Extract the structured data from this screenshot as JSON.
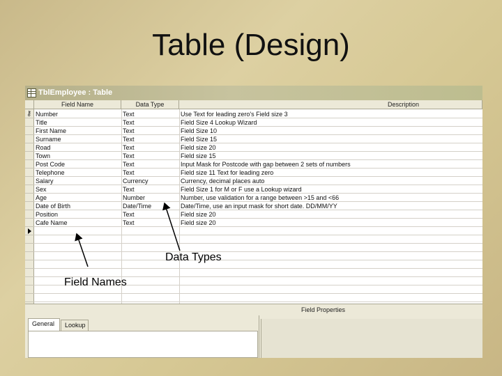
{
  "slide": {
    "title": "Table (Design)"
  },
  "window": {
    "title": "TblEmployee : Table",
    "icon": "table-icon"
  },
  "grid": {
    "headers": {
      "field_name": "Field Name",
      "data_type": "Data Type",
      "description": "Description"
    },
    "rows": [
      {
        "name": "Number",
        "type": "Text",
        "desc": "Use Text for leading zero's Field size 3"
      },
      {
        "name": "Title",
        "type": "Text",
        "desc": "Field Size 4  Lookup Wizard"
      },
      {
        "name": "First Name",
        "type": "Text",
        "desc": "Field Size 10"
      },
      {
        "name": "Surname",
        "type": "Text",
        "desc": "Field Size 15"
      },
      {
        "name": "Road",
        "type": "Text",
        "desc": "Field size 20"
      },
      {
        "name": "Town",
        "type": "Text",
        "desc": "Field size 15"
      },
      {
        "name": "Post Code",
        "type": "Text",
        "desc": "Input Mask for Postcode with gap between 2 sets of numbers"
      },
      {
        "name": "Telephone",
        "type": "Text",
        "desc": "Field size 11 Text for leading zero"
      },
      {
        "name": "Salary",
        "type": "Currency",
        "desc": "Currency, decimal places auto"
      },
      {
        "name": "Sex",
        "type": "Text",
        "desc": "Field Size 1 for M or F use a Lookup wizard"
      },
      {
        "name": "Age",
        "type": "Number",
        "desc": "Number, use validation for a range between >15 and <66"
      },
      {
        "name": "Date of Birth",
        "type": "Date/Time",
        "desc": "Date/Time, use an input mask for short date. DD/MM/YY"
      },
      {
        "name": "Position",
        "type": "Text",
        "desc": "Field size 20"
      },
      {
        "name": "Cafe Name",
        "type": "Text",
        "desc": "Field size 20"
      }
    ],
    "primary_key_row": 0,
    "current_row": 14
  },
  "properties": {
    "header": "Field Properties",
    "tabs": [
      "General",
      "Lookup"
    ],
    "active_tab": "General"
  },
  "callouts": {
    "data_types": "Data Types",
    "field_names": "Field Names"
  }
}
